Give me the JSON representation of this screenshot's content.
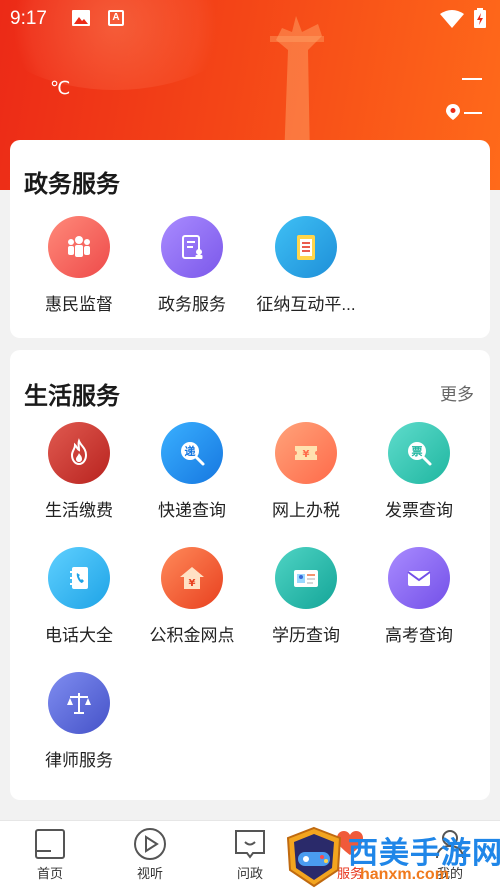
{
  "status_bar": {
    "time": "9:17",
    "app_icon_letter": "A"
  },
  "header": {
    "temperature_unit": "℃"
  },
  "gov_services": {
    "title": "政务服务",
    "items": [
      {
        "label": "惠民监督",
        "icon": "people-group-icon",
        "color": "#f05a5a"
      },
      {
        "label": "政务服务",
        "icon": "document-person-icon",
        "color": "#8f6ef0"
      },
      {
        "label": "征纳互动平...",
        "icon": "clipboard-list-icon",
        "color": "#2ea9e8"
      }
    ]
  },
  "life_services": {
    "title": "生活服务",
    "more": "更多",
    "items": [
      {
        "label": "生活缴费",
        "icon": "flame-icon",
        "color": "#d23a36"
      },
      {
        "label": "快递查询",
        "icon": "search-express-icon",
        "glyph": "递",
        "color": "#2196f3"
      },
      {
        "label": "网上办税",
        "icon": "ticket-yen-icon",
        "color": "#ff7a4a"
      },
      {
        "label": "发票查询",
        "icon": "search-invoice-icon",
        "glyph": "票",
        "color": "#2cc3b0"
      },
      {
        "label": "电话大全",
        "icon": "phone-book-icon",
        "color": "#2db4f0"
      },
      {
        "label": "公积金网点",
        "icon": "house-yen-icon",
        "color": "#f0582e"
      },
      {
        "label": "学历查询",
        "icon": "id-card-icon",
        "color": "#22b3a6"
      },
      {
        "label": "高考查询",
        "icon": "envelope-icon",
        "color": "#8d6bf0"
      },
      {
        "label": "律师服务",
        "icon": "scales-icon",
        "color": "#5e6bd8"
      }
    ]
  },
  "bottom_nav": [
    {
      "label": "首页",
      "icon": "home-square-icon"
    },
    {
      "label": "视听",
      "icon": "play-circle-icon"
    },
    {
      "label": "问政",
      "icon": "chat-bubble-icon"
    },
    {
      "label": "服务",
      "icon": "heart-hands-icon",
      "active": true
    },
    {
      "label": "我的",
      "icon": "person-icon"
    }
  ],
  "watermark": {
    "text": "西美手游网",
    "url": "hanxm.com"
  },
  "colors": {
    "primary": "#ec2a17",
    "accent": "#ff6a1a",
    "active_nav": "#e8331b"
  }
}
